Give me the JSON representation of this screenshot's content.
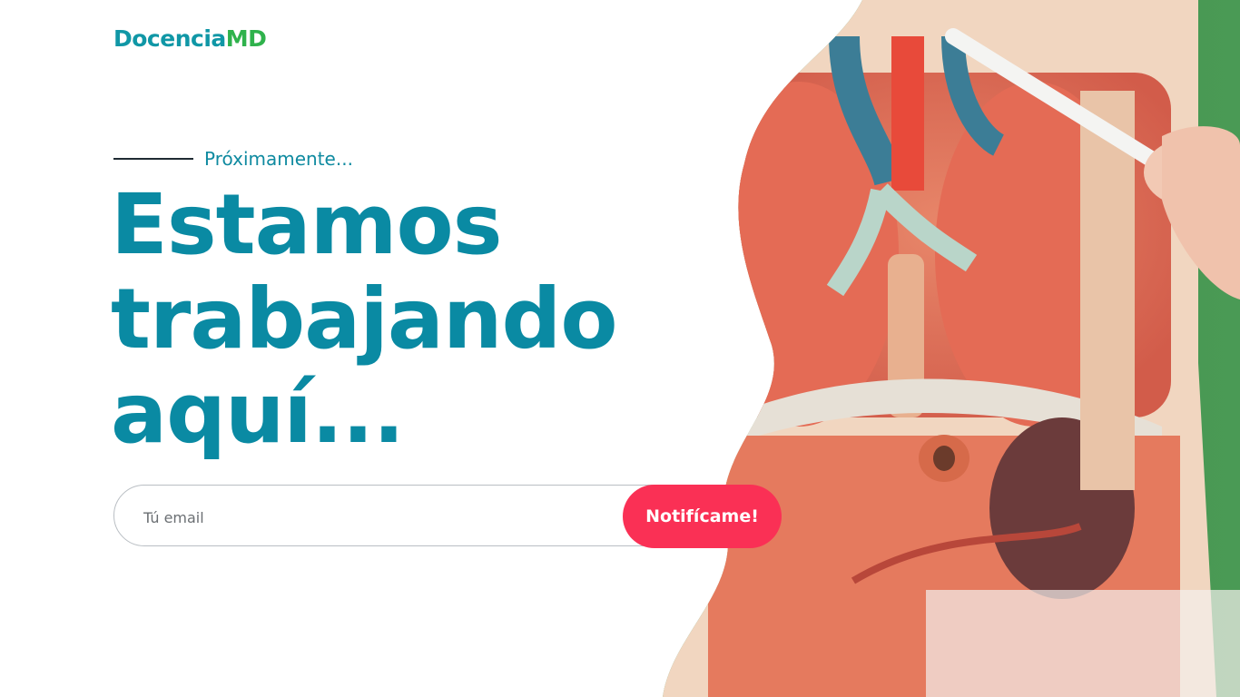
{
  "brand": {
    "name_main": "Docencia",
    "name_accent": "MD"
  },
  "hero": {
    "eyebrow": "Próximamente...",
    "headline": [
      "Estamos",
      "trabajando",
      "aquí..."
    ]
  },
  "signup": {
    "email_placeholder": "Tú email",
    "email_value": "",
    "button_label": "Notifícame!"
  },
  "colors": {
    "brand_teal": "#0a8aa3",
    "brand_green": "#2fb24c",
    "button": "#fa3055"
  },
  "image": {
    "subject": "anatomical torso model"
  }
}
